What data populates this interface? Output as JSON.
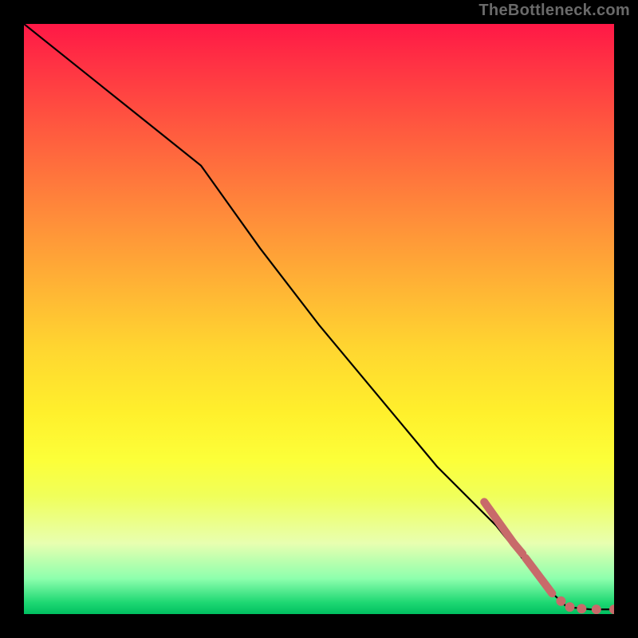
{
  "watermark": "TheBottleneck.com",
  "colors": {
    "dot": "#c86a6a",
    "line": "#000000"
  },
  "chart_data": {
    "type": "line",
    "title": "",
    "xlabel": "",
    "ylabel": "",
    "xlim": [
      0,
      100
    ],
    "ylim": [
      0,
      100
    ],
    "grid": false,
    "series": [
      {
        "name": "curve",
        "x": [
          0,
          10,
          20,
          30,
          40,
          50,
          60,
          70,
          80,
          88,
          92,
          96,
          100
        ],
        "y": [
          100,
          92,
          84,
          76,
          62,
          49,
          37,
          25,
          15,
          5,
          1.2,
          0.8,
          0.8
        ]
      }
    ],
    "markers": [
      {
        "type": "segment",
        "x0": 78,
        "y0": 19,
        "x1": 83,
        "y1": 12
      },
      {
        "type": "segment",
        "x0": 83,
        "y0": 12,
        "x1": 84.5,
        "y1": 10.2
      },
      {
        "type": "segment",
        "x0": 85,
        "y0": 9.5,
        "x1": 88,
        "y1": 5.5
      },
      {
        "type": "segment",
        "x0": 88,
        "y0": 5.5,
        "x1": 89.5,
        "y1": 3.5
      },
      {
        "type": "dot",
        "x": 91,
        "y": 2.2
      },
      {
        "type": "dot",
        "x": 92.5,
        "y": 1.2
      },
      {
        "type": "dot",
        "x": 94.5,
        "y": 0.9
      },
      {
        "type": "dot",
        "x": 97,
        "y": 0.8
      },
      {
        "type": "dot",
        "x": 100,
        "y": 0.8
      }
    ]
  }
}
